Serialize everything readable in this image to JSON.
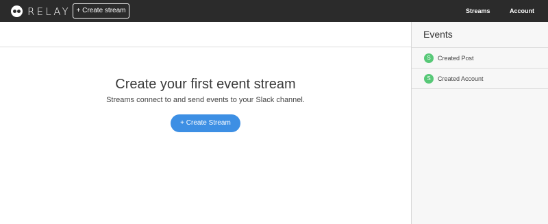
{
  "header": {
    "logo_text": "RELAY",
    "create_stream_label": "+ Create stream",
    "nav": [
      {
        "label": "Streams"
      },
      {
        "label": "Account"
      }
    ]
  },
  "main": {
    "empty_title": "Create your first event stream",
    "empty_subtitle": "Streams connect to and send events to your Slack channel.",
    "create_button_label": "+ Create Stream"
  },
  "sidebar": {
    "title": "Events",
    "events": [
      {
        "badge": "S",
        "label": "Created Post"
      },
      {
        "badge": "S",
        "label": "Created Account"
      }
    ]
  },
  "colors": {
    "topbar": "#2b2b2b",
    "accent_blue": "#3d8fe4",
    "badge_green": "#57c877"
  }
}
